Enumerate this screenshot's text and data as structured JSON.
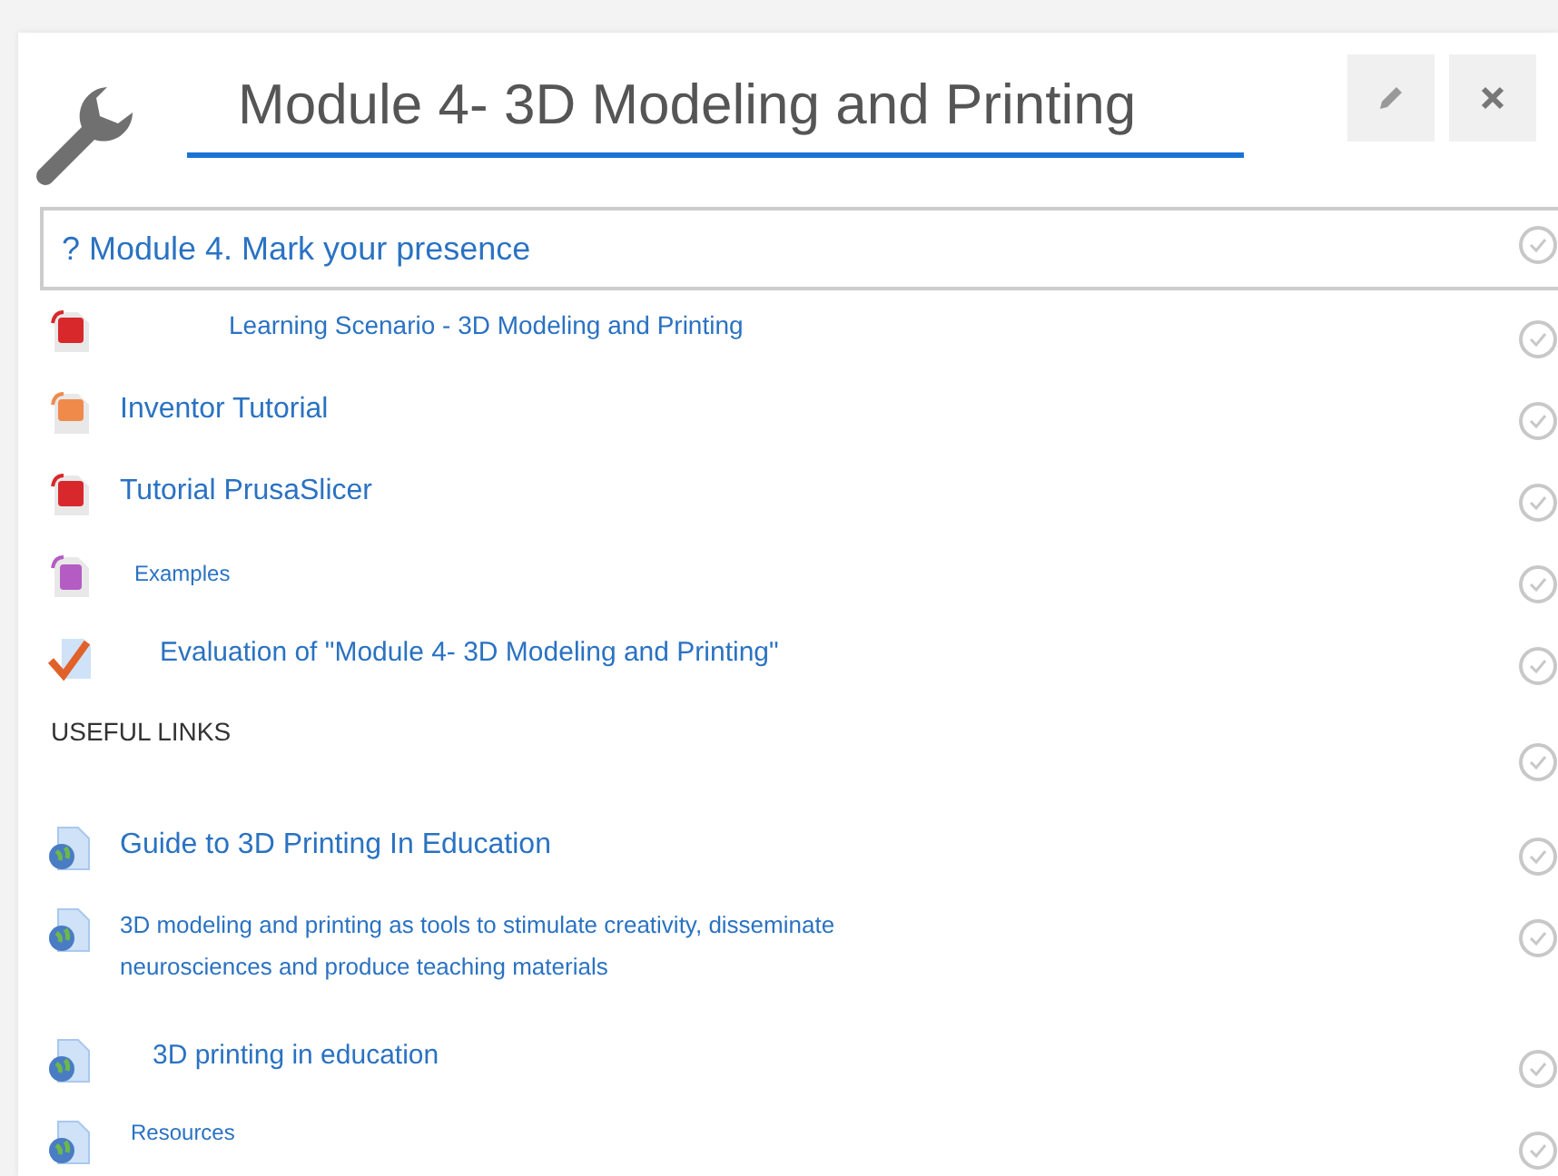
{
  "section": {
    "title": "Module 4- 3D Modeling and Printing"
  },
  "activities": [
    {
      "kind": "attendance",
      "title": "? Module 4. Mark your presence",
      "completed": false
    },
    {
      "kind": "pdf",
      "title": "Learning Scenario - 3D Modeling and Printing",
      "completed": false
    },
    {
      "kind": "slides",
      "title": "Inventor Tutorial",
      "completed": false
    },
    {
      "kind": "pdf",
      "title": "Tutorial PrusaSlicer",
      "completed": false
    },
    {
      "kind": "archive",
      "title": "Examples",
      "completed": false
    },
    {
      "kind": "quiz",
      "title": "Evaluation of \"Module 4- 3D Modeling and Printing\"",
      "completed": false
    },
    {
      "kind": "label",
      "title": "USEFUL LINKS",
      "completed": false
    },
    {
      "kind": "url",
      "title": "Guide to 3D Printing In Education",
      "completed": false
    },
    {
      "kind": "url",
      "title": "3D modeling and printing as tools to stimulate creativity, disseminate neurosciences and produce teaching materials",
      "completed": false
    },
    {
      "kind": "url",
      "title": "3D printing in education",
      "completed": false
    },
    {
      "kind": "url",
      "title": "Resources",
      "completed": false
    }
  ]
}
